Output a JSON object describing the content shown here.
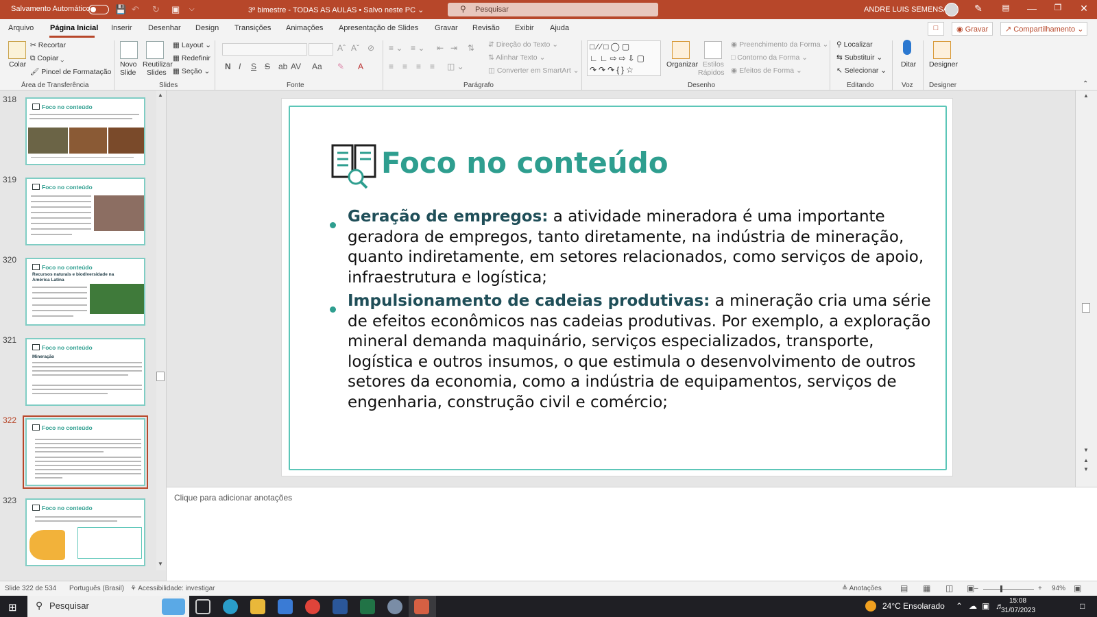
{
  "titlebar": {
    "autosave_label": "Salvamento Automático",
    "document": "3º bimestre - TODAS AS AULAS • Salvo neste PC ⌄",
    "search_placeholder": "Pesquisar",
    "user_name": "ANDRE LUIS SEMENSATO"
  },
  "menu": {
    "tabs": [
      "Arquivo",
      "Página Inicial",
      "Inserir",
      "Desenhar",
      "Design",
      "Transições",
      "Animações",
      "Apresentação de Slides",
      "Gravar",
      "Revisão",
      "Exibir",
      "Ajuda"
    ],
    "record_label": "Gravar",
    "share_label": "Compartilhamento"
  },
  "ribbon": {
    "groups": {
      "clipboard": "Área de Transferência",
      "slides": "Slides",
      "font": "Fonte",
      "paragraph": "Parágrafo",
      "drawing": "Desenho",
      "editing": "Editando",
      "voice": "Voz",
      "designer": "Designer"
    },
    "clipboard": {
      "paste": "Colar",
      "cut": "Recortar",
      "copy": "Copiar",
      "format_painter": "Pincel de Formatação"
    },
    "slides": {
      "new_slide_1": "Novo",
      "new_slide_2": "Slide",
      "reuse_1": "Reutilizar",
      "reuse_2": "Slides",
      "layout": "Layout",
      "reset": "Redefinir",
      "section": "Seção"
    },
    "paragraph": {
      "text_direction": "Direção do Texto",
      "align_text": "Alinhar Texto",
      "smartart": "Converter em SmartArt"
    },
    "drawing": {
      "arrange": "Organizar",
      "quick_styles_1": "Estilos",
      "quick_styles_2": "Rápidos",
      "fill": "Preenchimento da Forma",
      "outline": "Contorno da Forma",
      "effects": "Efeitos de Forma"
    },
    "editing": {
      "find": "Localizar",
      "replace": "Substituir",
      "select": "Selecionar"
    },
    "voice": {
      "dictate": "Ditar"
    },
    "designer": {
      "designer": "Designer"
    }
  },
  "thumbnails": [
    {
      "number": "318",
      "title": "Foco no conteúdo"
    },
    {
      "number": "319",
      "title": "Foco no conteúdo"
    },
    {
      "number": "320",
      "title": "Foco no conteúdo",
      "subtitle": "Recursos naturais e biodiversidade na América Latina"
    },
    {
      "number": "321",
      "title": "Foco no conteúdo",
      "subtitle": "Mineração"
    },
    {
      "number": "322",
      "title": "Foco no conteúdo"
    },
    {
      "number": "323",
      "title": "Foco no conteúdo"
    }
  ],
  "slide": {
    "title": "Foco no conteúdo",
    "bullets": [
      {
        "heading": "Geração de empregos:",
        "text": " a atividade mineradora é uma importante geradora de empregos, tanto diretamente, na indústria de mineração, quanto indiretamente, em setores relacionados, como serviços de apoio, infraestrutura e logística;"
      },
      {
        "heading": "Impulsionamento de cadeias produtivas:",
        "text": " a mineração cria uma série de efeitos econômicos nas cadeias produtivas. Por exemplo, a exploração mineral demanda maquinário, serviços especializados, transporte, logística e outros insumos, o que estimula o desenvolvimento de outros setores da economia, como a indústria de equipamentos, serviços de engenharia, construção civil e comércio;"
      }
    ],
    "accent_color": "#2e9e8f"
  },
  "notes": {
    "placeholder": "Clique para adicionar anotações"
  },
  "status": {
    "slide_counter": "Slide 322 de 534",
    "language": "Português (Brasil)",
    "accessibility": "Acessibilidade: investigar",
    "notes_label": "Anotações",
    "zoom": "94%"
  },
  "taskbar": {
    "search_label": "Pesquisar",
    "weather": "24°C  Ensolarado",
    "time": "15:08",
    "date": "31/07/2023"
  }
}
